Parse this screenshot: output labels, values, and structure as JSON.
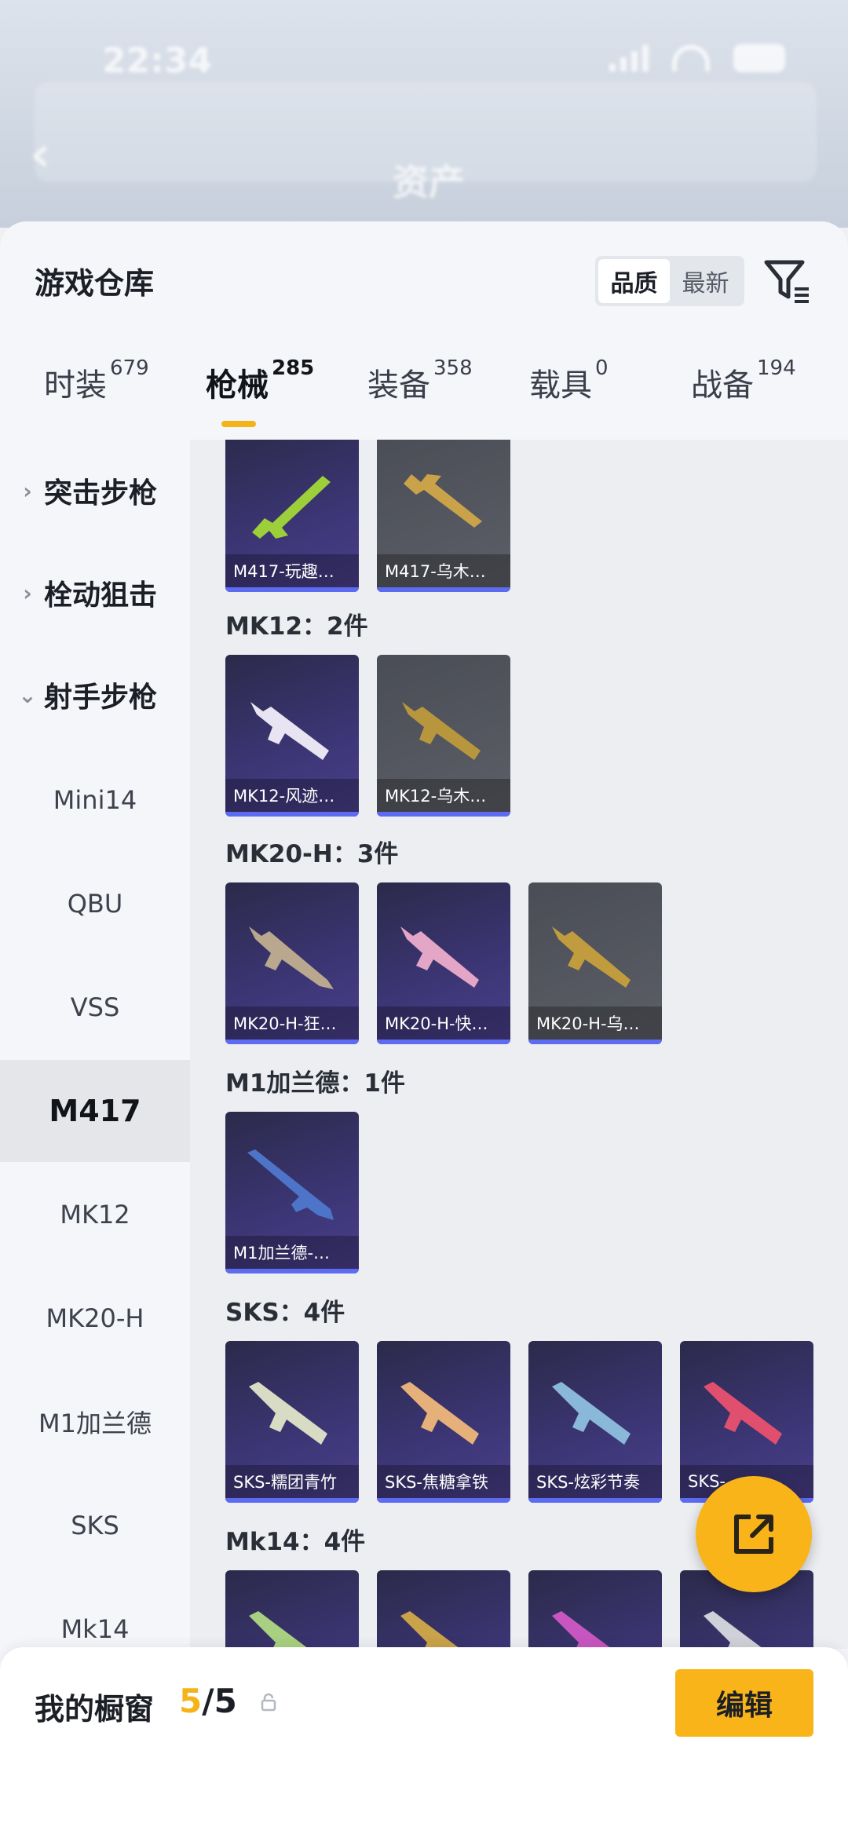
{
  "status": {
    "time": "22:34"
  },
  "header": {
    "title": "资产"
  },
  "sheet": {
    "title": "游戏仓库",
    "sort_options": [
      "品质",
      "最新"
    ]
  },
  "tabs": [
    {
      "label": "时装",
      "count": "679"
    },
    {
      "label": "枪械",
      "count": "285"
    },
    {
      "label": "装备",
      "count": "358"
    },
    {
      "label": "载具",
      "count": "0"
    },
    {
      "label": "战备",
      "count": "194"
    }
  ],
  "sidebar": {
    "groups": [
      "突击步枪",
      "栓动狙击",
      "射手步枪"
    ],
    "items": [
      "Mini14",
      "QBU",
      "VSS",
      "M417",
      "MK12",
      "MK20-H",
      "M1加兰德",
      "SKS",
      "Mk14"
    ]
  },
  "content": {
    "groups": [
      {
        "label": "",
        "items": [
          "M417-玩趣…",
          "M417-乌木…"
        ]
      },
      {
        "label": "MK12：2件",
        "items": [
          "MK12-风迹…",
          "MK12-乌木…"
        ]
      },
      {
        "label": "MK20-H：3件",
        "items": [
          "MK20-H-狂…",
          "MK20-H-快…",
          "MK20-H-乌…"
        ]
      },
      {
        "label": "M1加兰德：1件",
        "items": [
          "M1加兰德-…"
        ]
      },
      {
        "label": "SKS：4件",
        "items": [
          "SKS-糯团青竹",
          "SKS-焦糖拿铁",
          "SKS-炫彩节奏",
          "SKS-…"
        ]
      },
      {
        "label": "Mk14：4件",
        "items": [
          "",
          "",
          "",
          ""
        ]
      }
    ]
  },
  "bottom": {
    "showcase_label": "我的橱窗",
    "showcase_current": "5",
    "showcase_total": "/5",
    "edit_label": "编辑"
  },
  "colors": {
    "accent": "#f8b419",
    "card_purple": "#3b3573",
    "card_grey": "#5c5f67",
    "strip": "#5c6bf0"
  }
}
